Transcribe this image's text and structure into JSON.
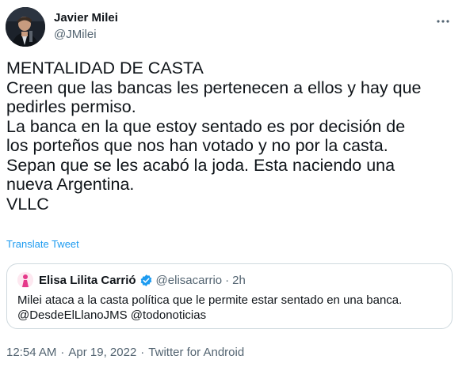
{
  "author": {
    "name": "Javier Milei",
    "handle": "@JMilei"
  },
  "tweet": {
    "lines": [
      "MENTALIDAD DE CASTA",
      "Creen que las bancas les pertenecen a ellos y hay que",
      "pedirles permiso.",
      "La banca en la que estoy sentado es por decisión de",
      "los porteños que nos han votado y no por la casta.",
      "Sepan que se les acabó la joda. Esta naciendo una",
      "nueva Argentina.",
      "VLLC"
    ],
    "translate_label": "Translate Tweet"
  },
  "quote": {
    "name": "Elisa Lilita Carrió",
    "handle": "@elisacarrio",
    "separator": "·",
    "time": "2h",
    "lines": [
      "Milei ataca a la casta política que le permite estar sentado en una banca.",
      "@DesdeElLlanoJMS @todonoticias"
    ]
  },
  "meta": {
    "time": "12:54 AM",
    "separator": "·",
    "date": "Apr 19, 2022",
    "source": "Twitter for Android"
  },
  "icons": {
    "more": "more-horizontal-icon",
    "verified": "verified-badge-icon"
  },
  "colors": {
    "link": "#1d9bf0",
    "secondary_text": "#536471",
    "border": "#cfd9de"
  }
}
